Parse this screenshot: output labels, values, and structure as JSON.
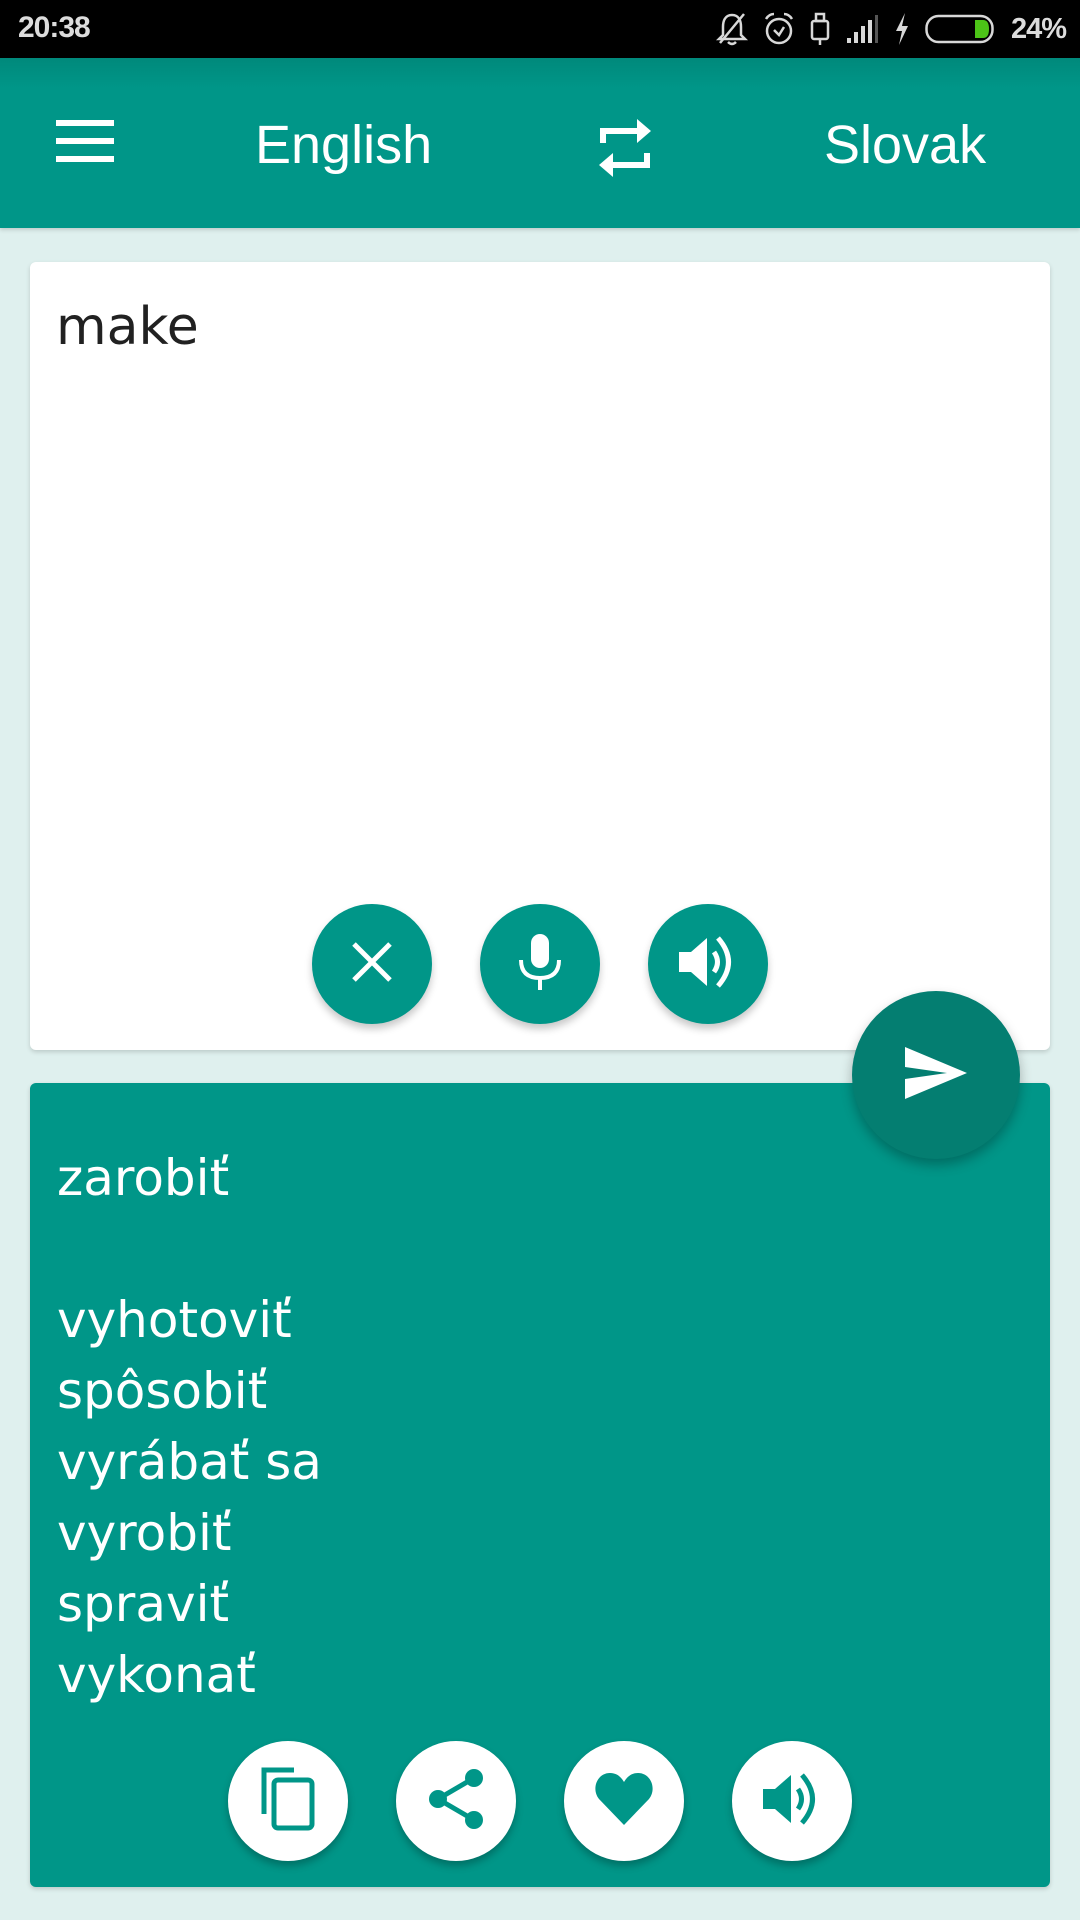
{
  "status_bar": {
    "time": "20:38",
    "icons": [
      "notifications-off-icon",
      "alarm-icon",
      "usb-icon",
      "signal-icon",
      "charging-icon",
      "battery-icon"
    ],
    "battery_percent": "24%",
    "battery_level": 0.24,
    "battery_color": "#4cc417"
  },
  "app_bar": {
    "menu_icon": "hamburger-menu-icon",
    "source_language": "English",
    "swap_icon": "swap-languages-icon",
    "target_language": "Slovak",
    "color": "#009688"
  },
  "input": {
    "value": "make",
    "buttons": [
      {
        "name": "clear",
        "icon": "close-icon"
      },
      {
        "name": "voice-input",
        "icon": "microphone-icon"
      },
      {
        "name": "speak-input",
        "icon": "speaker-icon"
      }
    ]
  },
  "send_button": {
    "icon": "send-icon",
    "color": "#047e71"
  },
  "output": {
    "lines": [
      "zarobiť",
      "",
      "vyhotoviť",
      "spôsobiť",
      "vyrábať sa",
      "vyrobiť",
      "spraviť",
      "vykonať"
    ],
    "buttons": [
      {
        "name": "copy",
        "icon": "copy-icon"
      },
      {
        "name": "share",
        "icon": "share-icon"
      },
      {
        "name": "favorite",
        "icon": "heart-icon"
      },
      {
        "name": "speak-output",
        "icon": "speaker-icon"
      }
    ]
  }
}
